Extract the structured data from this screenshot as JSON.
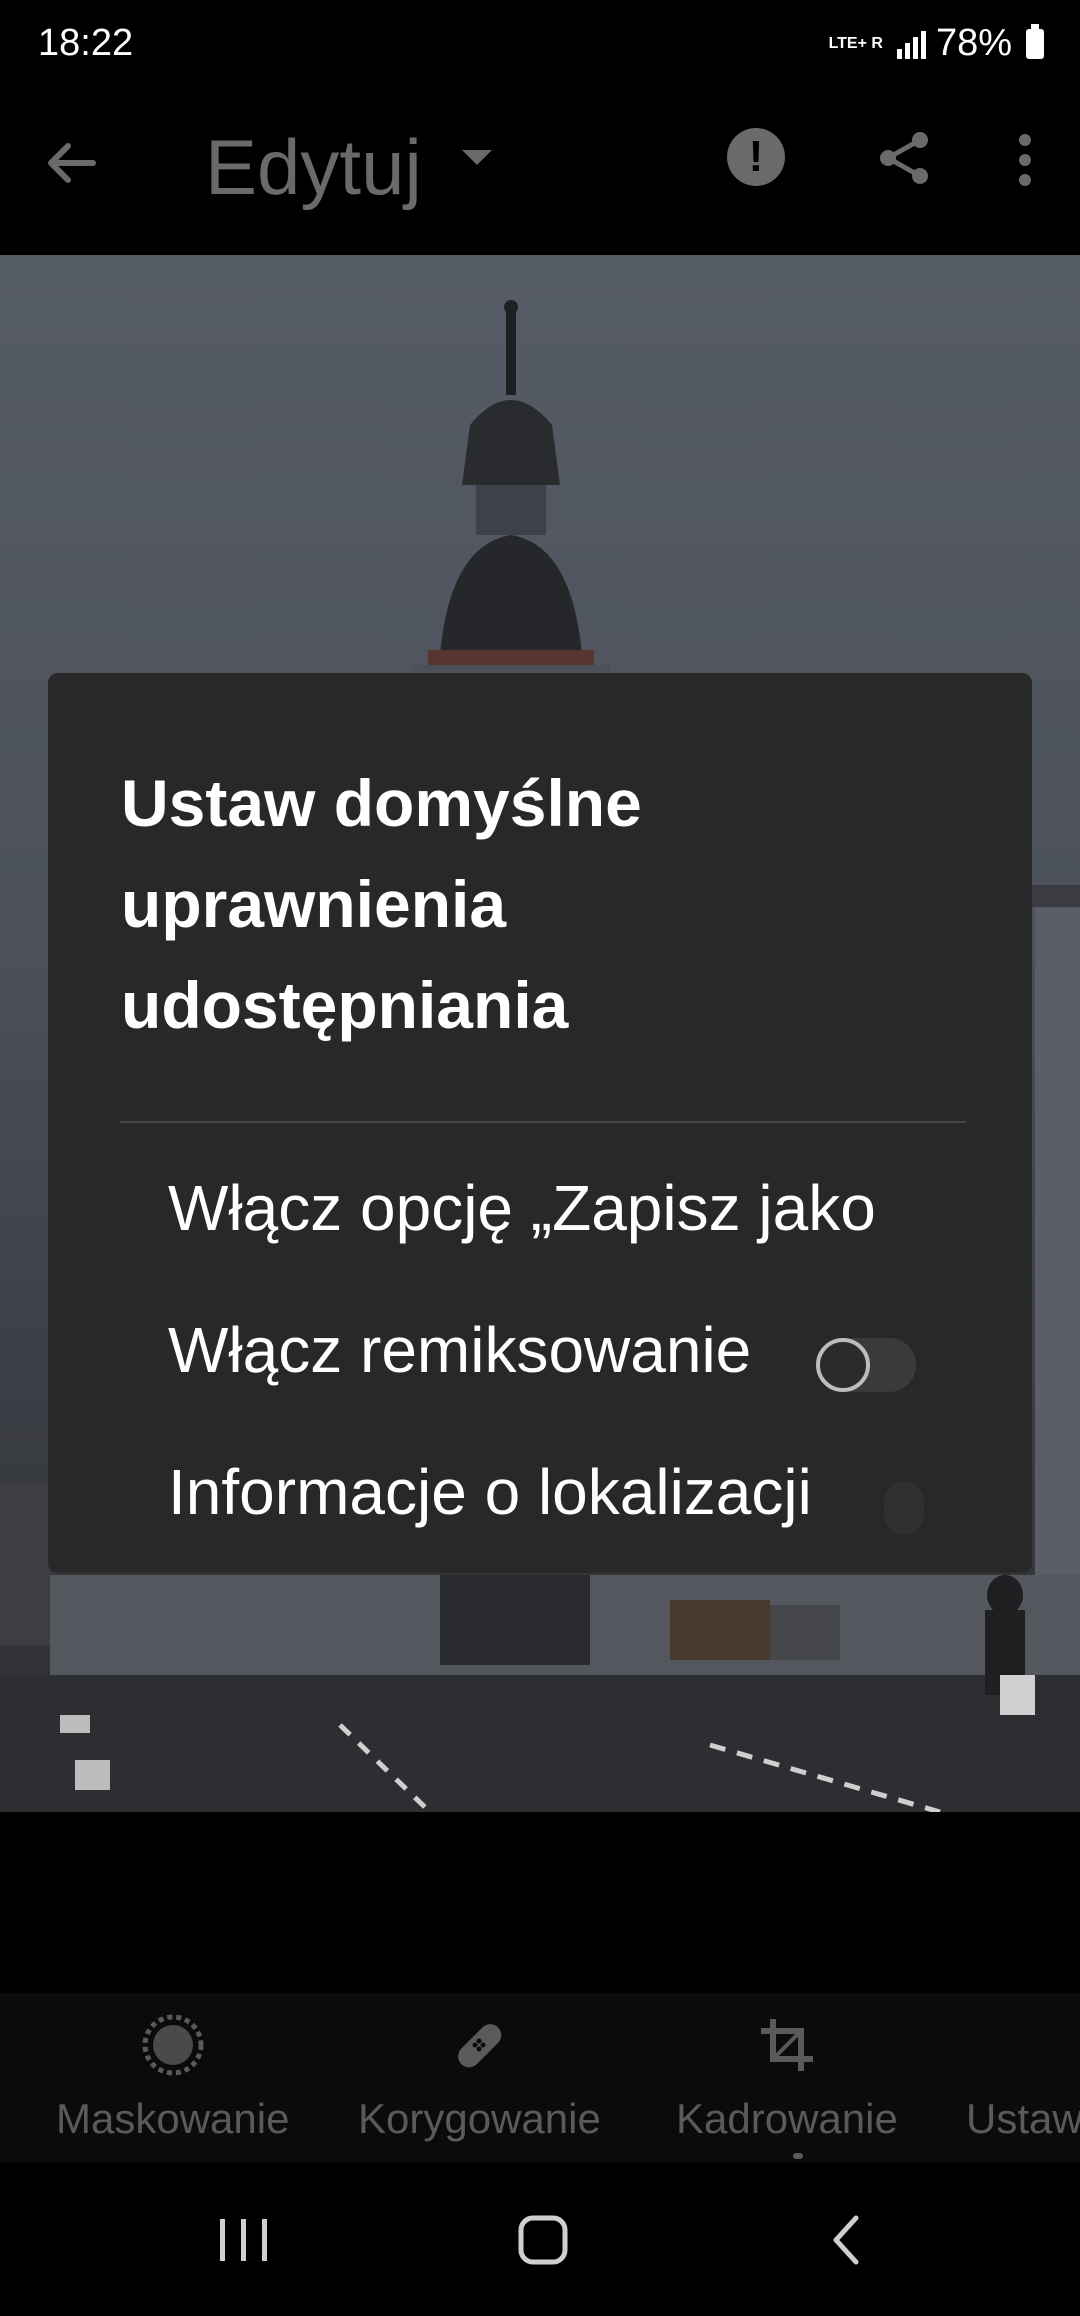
{
  "status_bar": {
    "time": "18:22",
    "network_top": "LTE+ R",
    "battery": "78%"
  },
  "app_bar": {
    "title": "Edytuj",
    "icons": [
      "back-arrow-icon",
      "alert-icon",
      "share-icon",
      "more-vert-icon"
    ]
  },
  "dialog": {
    "title": "Ustaw domyślne uprawnienia udostępniania",
    "options": [
      {
        "label": "Włącz opcję „Zapisz jako ustawienia",
        "has_toggle": false
      },
      {
        "label": "Włącz remiksowanie",
        "toggle_on": false
      },
      {
        "label": "Informacje o lokalizacji",
        "toggle_on": false
      }
    ]
  },
  "toolbar": {
    "items": [
      {
        "label": "Maskowanie",
        "icon": "masking-icon"
      },
      {
        "label": "Korygowanie",
        "icon": "bandage-icon"
      },
      {
        "label": "Kadrowanie",
        "icon": "crop-icon"
      },
      {
        "label": "Ustaw",
        "icon": "presets-icon"
      }
    ]
  },
  "nav_bar": {
    "icons": [
      "recents-icon",
      "home-icon",
      "back-icon"
    ]
  },
  "colors": {
    "background": "#000000",
    "dialog": "#282828",
    "muted_text": "#5a5a5a"
  }
}
